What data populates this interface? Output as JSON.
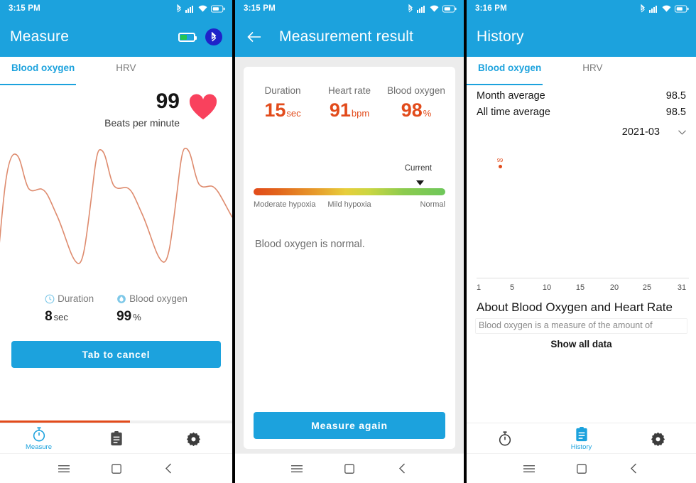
{
  "accent": "#1CA2DD",
  "danger": "#E24B1B",
  "screens": {
    "measure": {
      "status": {
        "time": "3:15 PM",
        "icons": [
          "bluetooth-icon",
          "signal-icon",
          "wifi-icon",
          "battery-icon"
        ]
      },
      "appbar": {
        "title": "Measure",
        "battery_toggle": "battery-toggle-icon",
        "bluetooth": "bluetooth-badge-icon"
      },
      "tabs": [
        {
          "label": "Blood oxygen",
          "active": true
        },
        {
          "label": "HRV",
          "active": false
        }
      ],
      "bpm": {
        "value": "99",
        "label": "Beats per minute",
        "icon": "heart-icon"
      },
      "stats": [
        {
          "icon": "clock-icon",
          "label": "Duration",
          "value": "8",
          "unit": "sec"
        },
        {
          "icon": "droplet-icon",
          "label": "Blood oxygen",
          "value": "99",
          "unit": "%"
        }
      ],
      "cancel_button": "Tab to cancel",
      "progress_percent": 56,
      "bottom_nav": [
        {
          "icon": "stopwatch-icon",
          "label": "Measure",
          "active": true
        },
        {
          "icon": "clipboard-icon",
          "label": "",
          "active": false
        },
        {
          "icon": "gear-icon",
          "label": "",
          "active": false
        }
      ]
    },
    "result": {
      "status": {
        "time": "3:15 PM"
      },
      "appbar": {
        "back": "back-arrow-icon",
        "title": "Measurement result"
      },
      "metrics": [
        {
          "label": "Duration",
          "value": "15",
          "unit": "sec"
        },
        {
          "label": "Heart rate",
          "value": "91",
          "unit": "bpm"
        },
        {
          "label": "Blood oxygen",
          "value": "98",
          "unit": "%"
        }
      ],
      "gauge": {
        "current_label": "Current",
        "current_position_percent": 89,
        "zone_left": "Moderate hypoxia",
        "zone_mid": "Mild hypoxia",
        "zone_right": "Normal"
      },
      "verdict": "Blood oxygen is normal.",
      "measure_again_button": "Measure again"
    },
    "history": {
      "status": {
        "time": "3:16 PM"
      },
      "appbar": {
        "title": "History"
      },
      "tabs": [
        {
          "label": "Blood oxygen",
          "active": true
        },
        {
          "label": "HRV",
          "active": false
        }
      ],
      "averages": [
        {
          "label": "Month average",
          "value": "98.5"
        },
        {
          "label": "All time average",
          "value": "98.5"
        }
      ],
      "month_selector": {
        "value": "2021-03",
        "icon": "chevron-down-icon"
      },
      "about_heading": "About Blood Oxygen and Heart Rate",
      "about_body": "Blood oxygen is a measure of the amount of",
      "show_all_button": "Show all data",
      "bottom_nav": [
        {
          "icon": "stopwatch-icon",
          "label": "",
          "active": false
        },
        {
          "icon": "clipboard-icon",
          "label": "History",
          "active": true
        },
        {
          "icon": "gear-icon",
          "label": "",
          "active": false
        }
      ]
    }
  },
  "system_nav": {
    "menu": "menu-icon",
    "home": "home-icon",
    "back": "back-icon"
  },
  "chart_data": [
    {
      "type": "line",
      "title": "PPG pulse waveform",
      "xlabel": "",
      "ylabel": "",
      "grid": false,
      "legend": "none",
      "x": [
        0,
        1,
        2,
        3,
        4,
        5,
        6,
        7,
        8,
        9,
        10,
        11,
        12,
        13,
        14,
        15,
        16,
        17,
        18,
        19,
        20,
        21,
        22,
        23,
        24,
        25,
        26,
        27,
        28,
        29,
        30
      ],
      "values": [
        20,
        62,
        96,
        74,
        58,
        60,
        55,
        44,
        32,
        20,
        8,
        2,
        12,
        62,
        97,
        78,
        60,
        61,
        56,
        46,
        34,
        22,
        10,
        3,
        14,
        64,
        96,
        79,
        61,
        62,
        57
      ]
    },
    {
      "type": "scatter",
      "title": "Monthly blood oxygen history",
      "xlabel": "",
      "ylabel": "",
      "grid": false,
      "legend": "none",
      "xticks": [
        1,
        5,
        10,
        15,
        20,
        25,
        31
      ],
      "xlim": [
        1,
        31
      ],
      "points": [
        {
          "x": 4,
          "y": 99,
          "label": "99"
        }
      ]
    }
  ]
}
